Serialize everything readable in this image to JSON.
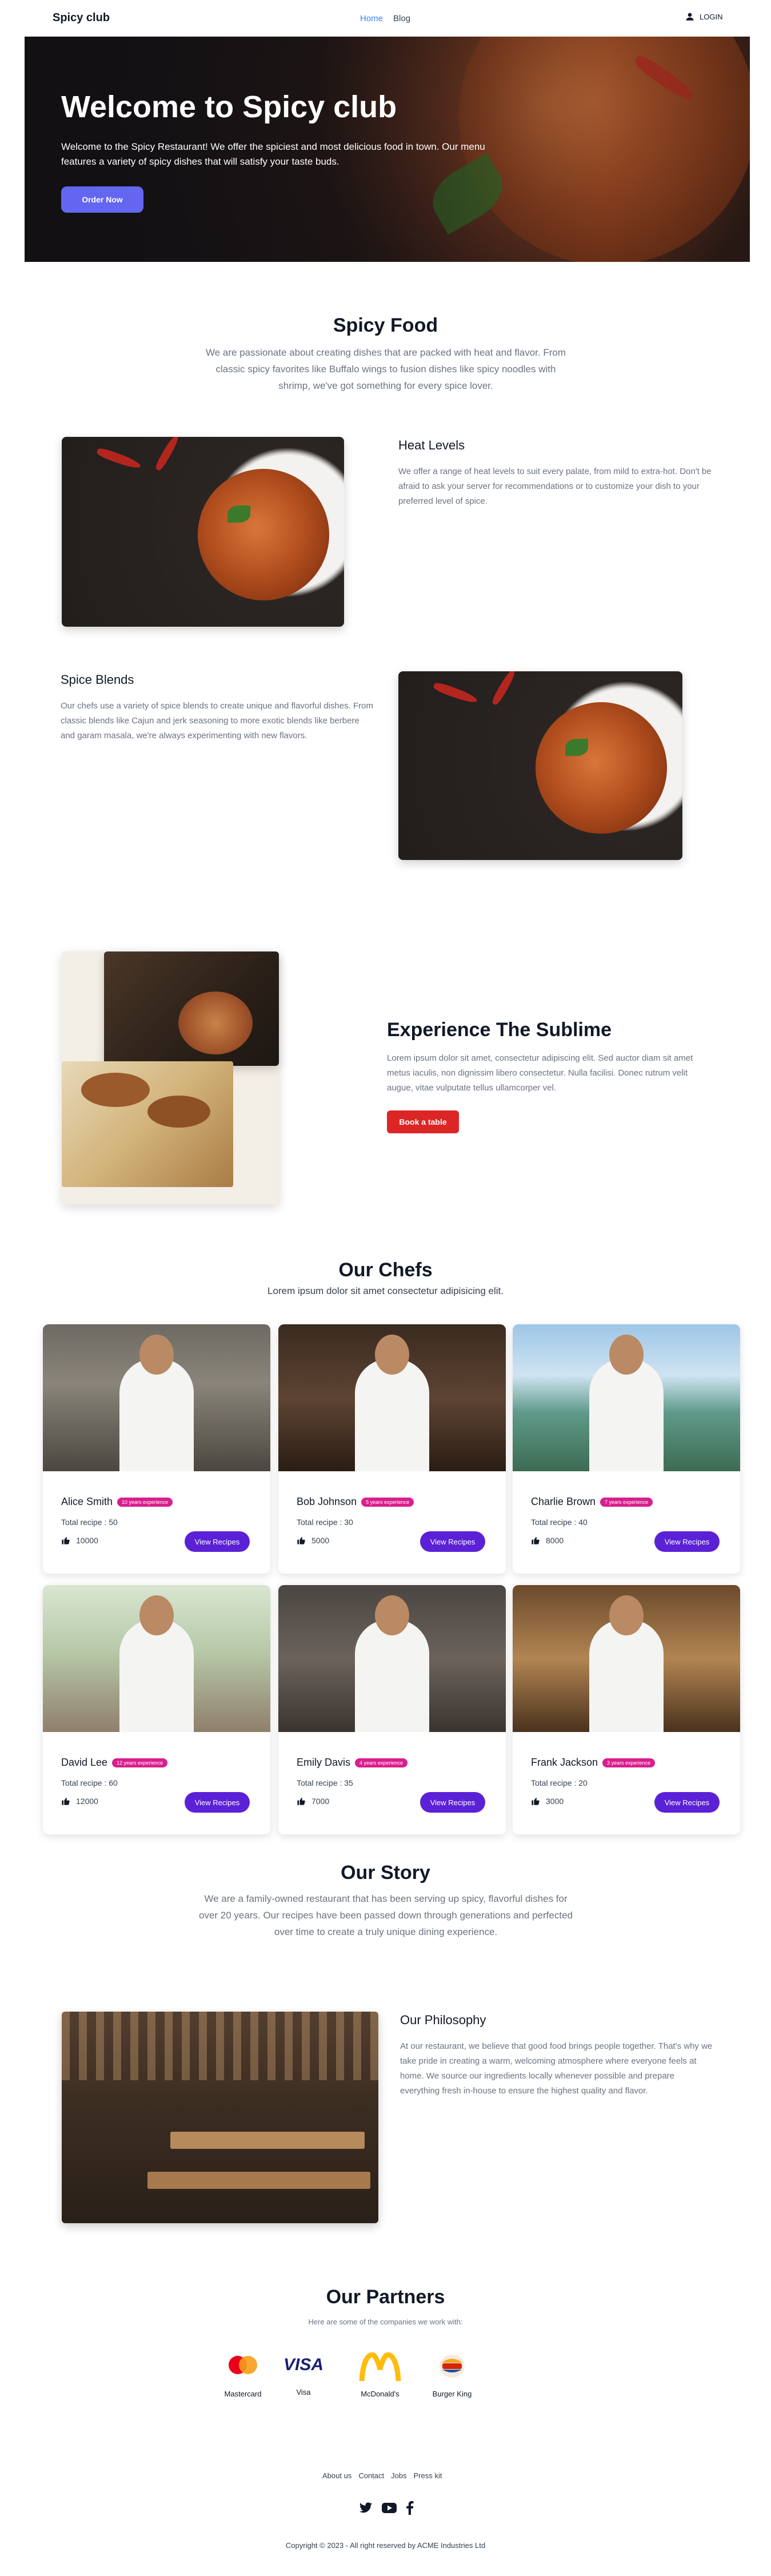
{
  "nav": {
    "brand": "Spicy club",
    "links": [
      "Home",
      "Blog"
    ],
    "login": "LOGIN"
  },
  "hero": {
    "title": "Welcome to Spicy club",
    "text": "Welcome to the Spicy Restaurant! We offer the spiciest and most delicious food in town. Our menu features a variety of spicy dishes that will satisfy your taste buds.",
    "button": "Order Now"
  },
  "spicy": {
    "title": "Spicy Food",
    "subtitle": "We are passionate about creating dishes that are packed with heat and flavor. From classic spicy favorites like Buffalo wings to fusion dishes like spicy noodles with shrimp, we've got something for every spice lover.",
    "heat_title": "Heat Levels",
    "heat_text": "We offer a range of heat levels to suit every palate, from mild to extra-hot. Don't be afraid to ask your server for recommendations or to customize your dish to your preferred level of spice.",
    "blends_title": "Spice Blends",
    "blends_text": "Our chefs use a variety of spice blends to create unique and flavorful dishes. From classic blends like Cajun and jerk seasoning to more exotic blends like berbere and garam masala, we're always experimenting with new flavors."
  },
  "sublime": {
    "title": "Experience The Sublime",
    "text": "Lorem ipsum dolor sit amet, consectetur adipiscing elit. Sed auctor diam sit amet metus iaculis, non dignissim libero consectetur. Nulla facilisi. Donec rutrum velit augue, vitae vulputate tellus ullamcorper vel.",
    "button": "Book a table"
  },
  "chefs": {
    "title": "Our Chefs",
    "subtitle": "Lorem ipsum dolor sit amet consectetur adipisicing elit.",
    "recipe_prefix": "Total recipe : ",
    "button": "View Recipes",
    "items": [
      {
        "name": "Alice Smith",
        "badge": "10 years experience",
        "recipes": "Total recipe : 50",
        "likes": "10000"
      },
      {
        "name": "Bob Johnson",
        "badge": "5 years experience",
        "recipes": "Total recipe : 30",
        "likes": "5000"
      },
      {
        "name": "Charlie Brown",
        "badge": "7 years experience",
        "recipes": "Total recipe : 40",
        "likes": "8000"
      },
      {
        "name": "David Lee",
        "badge": "12 years experience",
        "recipes": "Total recipe : 60",
        "likes": "12000"
      },
      {
        "name": "Emily Davis",
        "badge": "4 years experience",
        "recipes": "Total recipe : 35",
        "likes": "7000"
      },
      {
        "name": "Frank Jackson",
        "badge": "3 years experience",
        "recipes": "Total recipe : 20",
        "likes": "3000"
      }
    ]
  },
  "story": {
    "title": "Our Story",
    "text": "We are a family-owned restaurant that has been serving up spicy, flavorful dishes for over 20 years. Our recipes have been passed down through generations and perfected over time to create a truly unique dining experience.",
    "philosophy_title": "Our Philosophy",
    "philosophy_text": "At our restaurant, we believe that good food brings people together. That's why we take pride in creating a warm, welcoming atmosphere where everyone feels at home. We source our ingredients locally whenever possible and prepare everything fresh in-house to ensure the highest quality and flavor."
  },
  "partners": {
    "title": "Our Partners",
    "subtitle": "Here are some of the companies we work with:",
    "items": [
      {
        "name": "Mastercard",
        "logo": "mastercard-logo"
      },
      {
        "name": "Visa",
        "logo": "visa-logo",
        "wordmark": "VISA"
      },
      {
        "name": "McDonald's",
        "logo": "mcdonalds-logo"
      },
      {
        "name": "Burger King",
        "logo": "burger-king-logo"
      }
    ]
  },
  "footer": {
    "links": [
      "About us",
      "Contact",
      "Jobs",
      "Press kit"
    ],
    "social": [
      "twitter-icon",
      "youtube-icon",
      "facebook-icon"
    ],
    "copyright": "Copyright © 2023 - All right reserved by ACME Industries Ltd"
  },
  "colors": {
    "primary": "#6366f1",
    "chef_button": "#5b21d6",
    "badge": "#d91e8e",
    "book_button": "#dc2626"
  }
}
